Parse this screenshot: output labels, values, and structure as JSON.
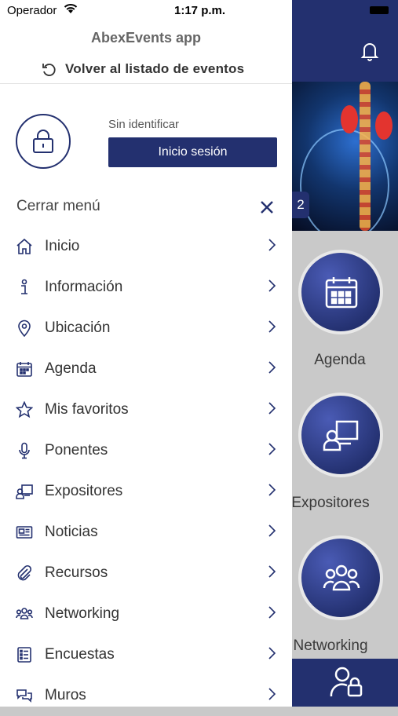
{
  "status_bar": {
    "carrier": "Operador",
    "time": "1:17 p.m."
  },
  "drawer": {
    "app_title": "AbexEvents app",
    "back_label": "Volver al listado de eventos",
    "user_status": "Sin identificar",
    "login_label": "Inicio sesión",
    "close_label": "Cerrar menú",
    "menu": [
      {
        "label": "Inicio",
        "icon": "home-icon"
      },
      {
        "label": "Información",
        "icon": "info-icon"
      },
      {
        "label": "Ubicación",
        "icon": "location-pin-icon"
      },
      {
        "label": "Agenda",
        "icon": "calendar-icon"
      },
      {
        "label": "Mis favoritos",
        "icon": "star-icon"
      },
      {
        "label": "Ponentes",
        "icon": "microphone-icon"
      },
      {
        "label": "Expositores",
        "icon": "presenter-icon"
      },
      {
        "label": "Noticias",
        "icon": "newspaper-icon"
      },
      {
        "label": "Recursos",
        "icon": "paperclip-icon"
      },
      {
        "label": "Networking",
        "icon": "group-icon"
      },
      {
        "label": "Encuestas",
        "icon": "survey-icon"
      },
      {
        "label": "Muros",
        "icon": "chat-icon"
      }
    ]
  },
  "background": {
    "banner_page": "2",
    "tiles": [
      {
        "label": "Agenda",
        "icon": "calendar-icon"
      },
      {
        "label": "Expositores",
        "icon": "presenter-icon"
      },
      {
        "label": "Networking",
        "icon": "group-icon"
      }
    ]
  },
  "colors": {
    "primary": "#23306f",
    "background_overlay": "#c9c9c9"
  }
}
